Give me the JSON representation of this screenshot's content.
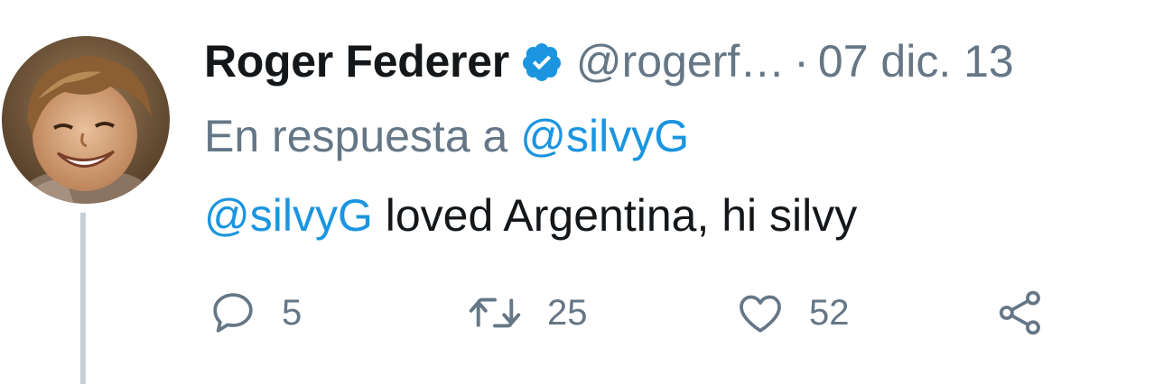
{
  "tweet": {
    "author_name": "Roger Federer",
    "verified_icon": "verified-badge-icon",
    "handle": "@rogerf…",
    "separator": "·",
    "date": "07 dic. 13",
    "reply_prefix": "En respuesta a",
    "reply_to": "@silvyG",
    "body_mention": "@silvyG",
    "body_text": " loved Argentina, hi silvy",
    "colors": {
      "accent": "#1b95e0",
      "secondary_text": "#657786",
      "primary_text": "#14171a",
      "thread_line": "#c4cfd6"
    }
  },
  "actions": {
    "reply": {
      "icon": "reply-icon",
      "count": "5"
    },
    "retweet": {
      "icon": "retweet-icon",
      "count": "25"
    },
    "like": {
      "icon": "heart-icon",
      "count": "52"
    },
    "share": {
      "icon": "share-icon"
    }
  }
}
